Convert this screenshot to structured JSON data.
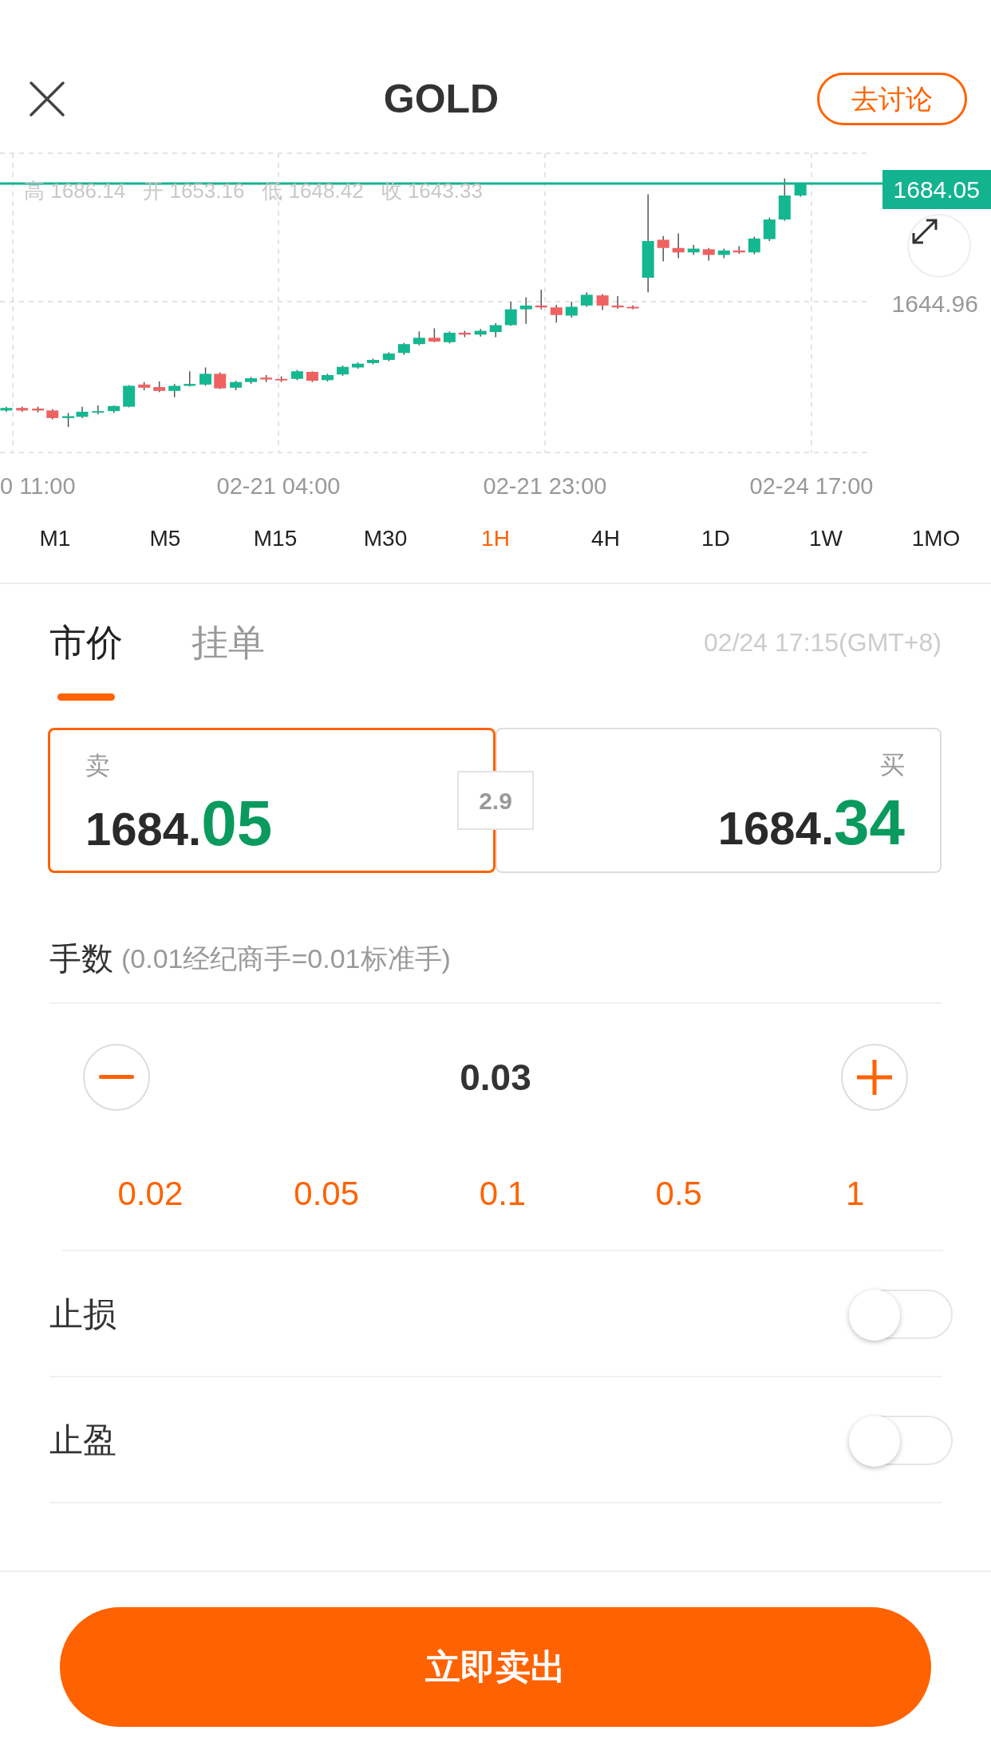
{
  "header": {
    "title": "GOLD",
    "discuss_button": "去讨论"
  },
  "chart": {
    "ohlc_legend": [
      {
        "label": "高",
        "value": "1686.14"
      },
      {
        "label": "开",
        "value": "1653.16"
      },
      {
        "label": "低",
        "value": "1648.42"
      },
      {
        "label": "收",
        "value": "1643.33"
      }
    ],
    "price_labels": [
      {
        "kind": "current",
        "text": "1684.05"
      },
      {
        "kind": "axis",
        "text": "1644.96"
      }
    ],
    "time_labels": [
      "0 11:00",
      "02-21 04:00",
      "02-21 23:00",
      "02-24 17:00"
    ]
  },
  "timeframes": [
    {
      "label": "M1",
      "selected": false
    },
    {
      "label": "M5",
      "selected": false
    },
    {
      "label": "M15",
      "selected": false
    },
    {
      "label": "M30",
      "selected": false
    },
    {
      "label": "1H",
      "selected": true
    },
    {
      "label": "4H",
      "selected": false
    },
    {
      "label": "1D",
      "selected": false
    },
    {
      "label": "1W",
      "selected": false
    },
    {
      "label": "1MO",
      "selected": false
    }
  ],
  "order_tabs": [
    {
      "label": "市价",
      "selected": true
    },
    {
      "label": "挂单",
      "selected": false
    }
  ],
  "timestamp": "02/24 17:15(GMT+8)",
  "quotes": [
    {
      "label": "卖",
      "integer": "1684.",
      "decimal": "05",
      "selected": true
    },
    {
      "label": "买",
      "integer": "1684.",
      "decimal": "34",
      "selected": false
    }
  ],
  "spread": "2.9",
  "lots": {
    "label": "手数",
    "hint": "(0.01经纪商手=0.01标准手)",
    "value": "0.03",
    "presets": [
      "0.02",
      "0.05",
      "0.1",
      "0.5",
      "1"
    ]
  },
  "toggles": [
    {
      "label": "止损",
      "on": false
    },
    {
      "label": "止盈",
      "on": false
    }
  ],
  "submit_button": "立即卖出"
}
